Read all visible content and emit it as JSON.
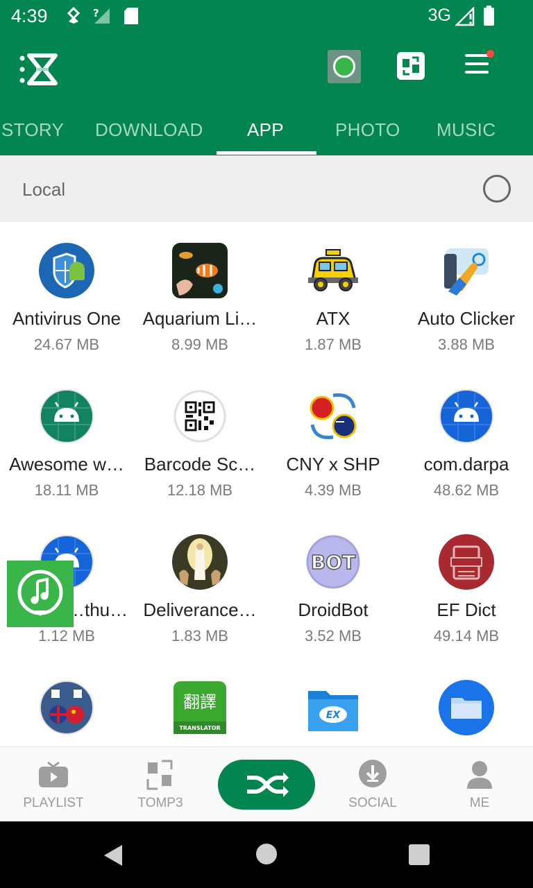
{
  "status_bar": {
    "time": "4:39",
    "network": "3G"
  },
  "tabs": [
    {
      "label": "STORY",
      "active": false
    },
    {
      "label": "DOWNLOAD",
      "active": false
    },
    {
      "label": "APP",
      "active": true
    },
    {
      "label": "PHOTO",
      "active": false
    },
    {
      "label": "MUSIC",
      "active": false
    }
  ],
  "section": {
    "label": "Local"
  },
  "apps": [
    {
      "name": "Antivirus One",
      "size": "24.67 MB",
      "icon": "shield-android-icon"
    },
    {
      "name": "Aquarium Li…",
      "size": "8.99 MB",
      "icon": "aquarium-icon"
    },
    {
      "name": "ATX",
      "size": "1.87 MB",
      "icon": "taxi-icon"
    },
    {
      "name": "Auto Clicker",
      "size": "3.88 MB",
      "icon": "auto-clicker-icon"
    },
    {
      "name": "Awesome w…",
      "size": "18.11 MB",
      "icon": "android-default-icon"
    },
    {
      "name": "Barcode Sc…",
      "size": "12.18 MB",
      "icon": "qr-code-icon"
    },
    {
      "name": "CNY x SHP",
      "size": "4.39 MB",
      "icon": "currency-exchange-icon"
    },
    {
      "name": "com.darpa",
      "size": "48.62 MB",
      "icon": "android-default-icon"
    },
    {
      "name": "…thub.…",
      "size": "1.12 MB",
      "icon": "android-default-icon"
    },
    {
      "name": "Deliverance…",
      "size": "1.83 MB",
      "icon": "religious-painting-icon"
    },
    {
      "name": "DroidBot",
      "size": "3.52 MB",
      "icon": "bot-icon"
    },
    {
      "name": "EF Dict",
      "size": "49.14 MB",
      "icon": "dictionary-icon"
    },
    {
      "name": "",
      "size": "",
      "icon": "translator-flags-icon"
    },
    {
      "name": "",
      "size": "",
      "icon": "translator-chinese-icon"
    },
    {
      "name": "",
      "size": "",
      "icon": "es-file-manager-icon"
    },
    {
      "name": "",
      "size": "",
      "icon": "folder-icon"
    }
  ],
  "bottom_nav": [
    {
      "label": "PLAYLIST",
      "icon": "tv-play-icon"
    },
    {
      "label": "TOMP3",
      "icon": "convert-icon"
    },
    {
      "label": "",
      "icon": "shuffle-icon"
    },
    {
      "label": "SOCIAL",
      "icon": "download-circle-icon"
    },
    {
      "label": "ME",
      "icon": "person-icon"
    }
  ],
  "colors": {
    "brand_green": "#02854e",
    "tab_inactive": "#a7d8c0",
    "badge_red": "#ff4b3e"
  }
}
